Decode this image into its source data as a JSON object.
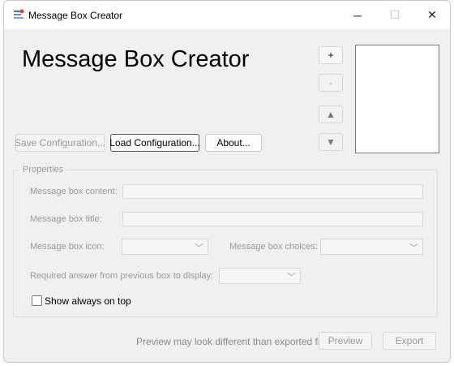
{
  "window": {
    "title": "Message Box Creator",
    "icon": "app-icon",
    "controls": {
      "minimize": "─",
      "maximize": "☐",
      "close": "✕"
    }
  },
  "header": {
    "title": "Message Box Creator"
  },
  "list_controls": {
    "add_label": "+",
    "remove_label": "-",
    "up_label": "▲",
    "down_label": "▼"
  },
  "config_buttons": {
    "save_label": "Save Configuration...",
    "load_label": "Load Configuration...",
    "about_label": "About..."
  },
  "properties": {
    "group_label": "Properties",
    "content_label": "Message box content:",
    "content_value": "",
    "title_label": "Message box title:",
    "title_value": "",
    "icon_label": "Message box icon:",
    "icon_value": "",
    "choices_label": "Message box choices:",
    "choices_value": "",
    "required_answer_label": "Required answer from previous box to display:",
    "required_answer_value": "",
    "show_on_top_label": "Show always on top",
    "show_on_top_checked": false
  },
  "footer": {
    "note": "Preview may look different than exported file.",
    "preview_label": "Preview",
    "export_label": "Export"
  }
}
